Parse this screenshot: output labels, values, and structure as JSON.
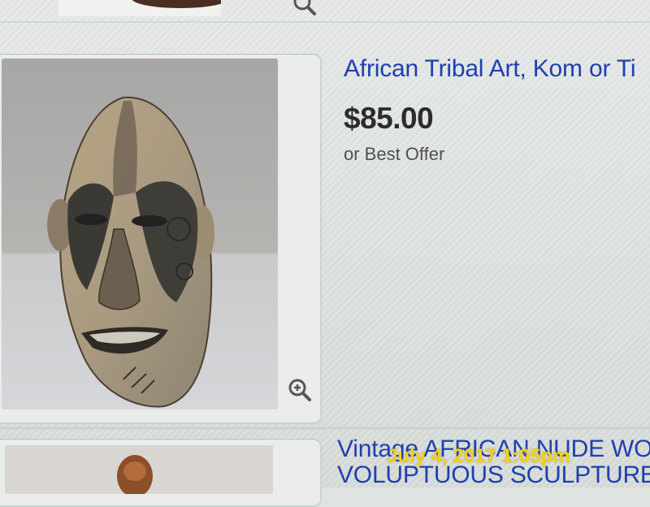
{
  "listings": [
    {
      "title": "African Tribal Art, Kom or Ti",
      "price": "$85.00",
      "price_note": "or Best Offer",
      "image_subject": "carved wooden tribal mask"
    },
    {
      "title_line1": "Vintage AFRICAN NUDE WO",
      "title_line2": "VOLUPTUOUS SCULPTURE",
      "image_subject": "carved wooden figure"
    }
  ],
  "photo_overlay": {
    "timestamp": "July 4, 2017 1:05pm"
  },
  "icons": {
    "zoom": "magnifier-plus-icon"
  },
  "colors": {
    "link": "#1f3fb0",
    "price": "#2c2c2c",
    "timestamp": "#f2d21a"
  }
}
